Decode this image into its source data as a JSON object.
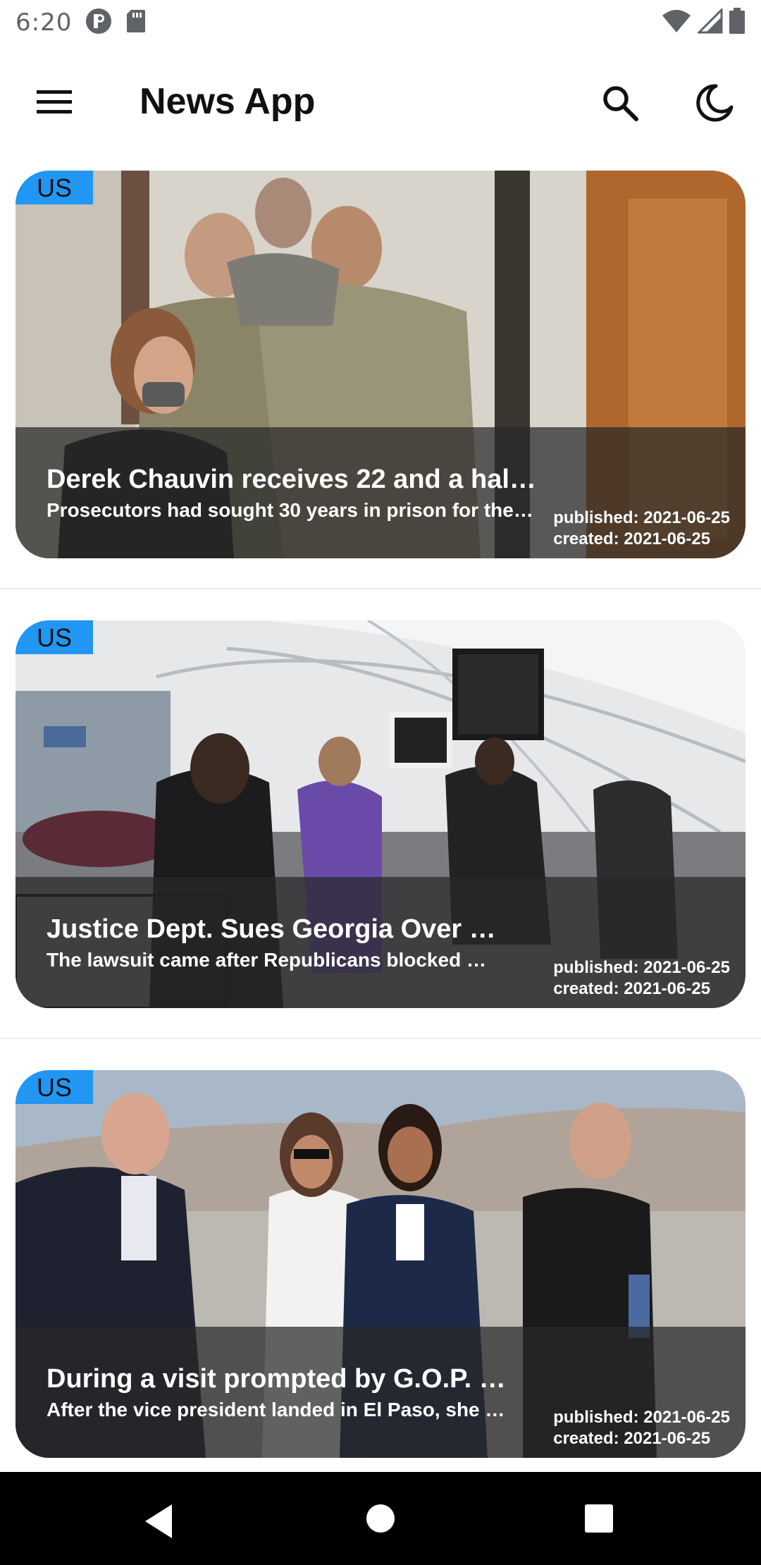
{
  "status_bar": {
    "time": "6:20",
    "icons": [
      "app-notification-icon",
      "sd-card-icon",
      "wifi-icon",
      "cell-signal-icon",
      "battery-icon"
    ]
  },
  "app_bar": {
    "title": "News App",
    "menu_icon": "hamburger-menu-icon",
    "search_icon": "search-icon",
    "theme_icon": "dark-mode-moon-icon"
  },
  "articles": [
    {
      "badge": "US",
      "title": "Derek Chauvin receives 22 and a hal…",
      "description": "Prosecutors had sought 30 years in prison for the…",
      "published": "published: 2021-06-25",
      "created": "created: 2021-06-25"
    },
    {
      "badge": "US",
      "title": "Justice Dept. Sues Georgia Over …",
      "description": "The lawsuit came after Republicans blocked …",
      "published": "published: 2021-06-25",
      "created": "created: 2021-06-25"
    },
    {
      "badge": "US",
      "title": "During a visit prompted by G.O.P. …",
      "description": "After the vice president landed in El Paso, she …",
      "published": "published: 2021-06-25",
      "created": "created: 2021-06-25"
    }
  ],
  "nav_bar": {
    "icons": [
      "back-icon",
      "home-icon",
      "recents-icon"
    ]
  },
  "colors": {
    "badge": "#2196f3",
    "overlay": "rgba(40,40,40,0.72)",
    "nav_bar": "#000000"
  }
}
